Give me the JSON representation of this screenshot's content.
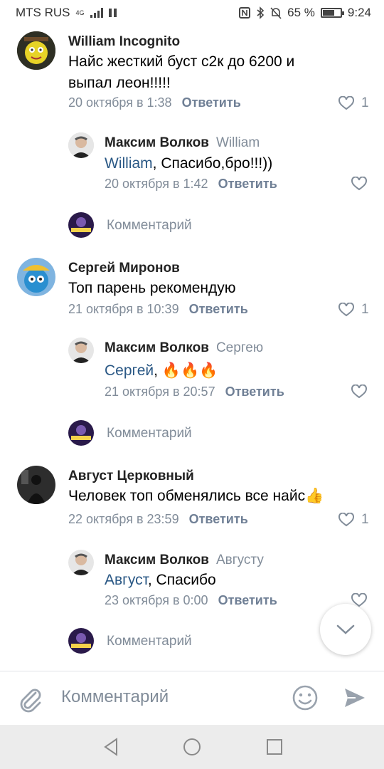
{
  "status_bar": {
    "carrier": "MTS RUS",
    "network": "4G",
    "battery_text": "65 %",
    "battery_level": 0.65,
    "time": "9:24"
  },
  "comments": [
    {
      "author": "William Incognito",
      "text_lines": [
        "Найс жесткий буст  с2к до 6200 и",
        "выпал леон!!!!!"
      ],
      "date": "20 октября в 1:38",
      "reply_label": "Ответить",
      "likes": "1",
      "reply": {
        "author": "Максим Волков",
        "reply_to": "William",
        "mention": "William",
        "text": ", Спасибо,бро!!!))",
        "date": "20 октября в 1:42",
        "reply_label": "Ответить"
      },
      "comment_stub": "Комментарий"
    },
    {
      "author": "Сергей Миронов",
      "text_lines": [
        "Топ парень рекомендую"
      ],
      "date": "21 октября в 10:39",
      "reply_label": "Ответить",
      "likes": "1",
      "reply": {
        "author": "Максим Волков",
        "reply_to": "Сергею",
        "mention": "Сергей",
        "text": ", 🔥🔥🔥",
        "date": "21 октября в 20:57",
        "reply_label": "Ответить"
      },
      "comment_stub": "Комментарий"
    },
    {
      "author": "Август Церковный",
      "text_lines": [
        "Человек топ обменялись все найс👍"
      ],
      "date": "22 октября в 23:59",
      "reply_label": "Ответить",
      "likes": "1",
      "reply": {
        "author": "Максим Волков",
        "reply_to": "Августу",
        "mention": "Август",
        "text": ", Спасибо",
        "date": "23 октября в 0:00",
        "reply_label": "Ответить"
      },
      "comment_stub": "Комментарий"
    }
  ],
  "composer": {
    "placeholder": "Комментарий"
  },
  "colors": {
    "link": "#2a5885",
    "meta": "#818c99",
    "accent": "#5181b8"
  }
}
